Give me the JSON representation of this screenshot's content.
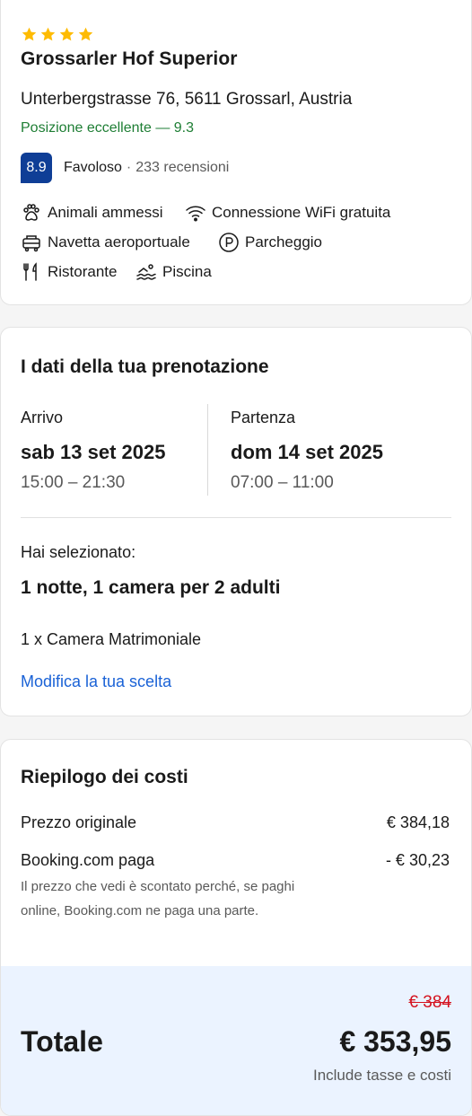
{
  "hotel": {
    "stars": 4,
    "name": "Grossarler Hof Superior",
    "address": "Unterbergstrasse 76, 5611 Grossarl, Austria",
    "location_rating": "Posizione eccellente — 9.3",
    "score": "8.9",
    "score_word": "Favoloso",
    "score_separator": "·",
    "reviews": "233 recensioni",
    "amenities": [
      {
        "icon": "paw-icon",
        "label": "Animali ammessi"
      },
      {
        "icon": "wifi-icon",
        "label": "Connessione WiFi gratuita"
      },
      {
        "icon": "shuttle-icon",
        "label": "Navetta aeroportuale"
      },
      {
        "icon": "parking-icon",
        "label": "Parcheggio"
      },
      {
        "icon": "restaurant-icon",
        "label": "Ristorante"
      },
      {
        "icon": "pool-icon",
        "label": "Piscina"
      }
    ]
  },
  "booking": {
    "title": "I dati della tua prenotazione",
    "checkin": {
      "label": "Arrivo",
      "date": "sab 13 set 2025",
      "time": "15:00 – 21:30"
    },
    "checkout": {
      "label": "Partenza",
      "date": "dom 14 set 2025",
      "time": "07:00 – 11:00"
    },
    "selected_label": "Hai selezionato:",
    "selected_value": "1 notte, 1 camera per 2 adulti",
    "room": "1 x Camera Matrimoniale",
    "modify_link": "Modifica la tua scelta"
  },
  "costs": {
    "title": "Riepilogo dei costi",
    "original_label": "Prezzo originale",
    "original_value": "€ 384,18",
    "discount_label": "Booking.com paga",
    "discount_value": "- € 30,23",
    "discount_note": "Il prezzo che vedi è scontato perché, se paghi online, Booking.com ne paga una parte.",
    "old_price": "€ 384",
    "total_label": "Totale",
    "total_value": "€ 353,95",
    "tax_note": "Include tasse e costi"
  },
  "colors": {
    "score_badge": "#0f3e96",
    "location_green": "#1e7e34",
    "link_blue": "#1a62d6",
    "strike_red": "#d4111e",
    "total_bg": "#ebf3ff",
    "star_yellow": "#febb02"
  }
}
